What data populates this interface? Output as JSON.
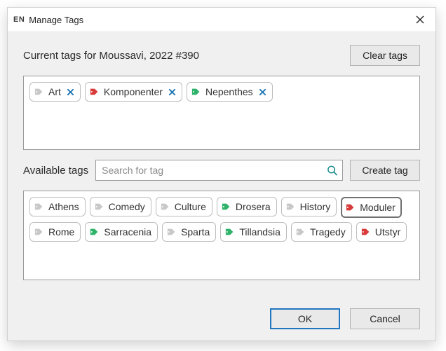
{
  "titlebar": {
    "app_badge": "EN",
    "title": "Manage Tags"
  },
  "header": {
    "current_tags_prefix": "Current tags for ",
    "reference": "Moussavi, 2022 #390",
    "clear_button": "Clear tags"
  },
  "current_tags": [
    {
      "label": "Art",
      "color": "#c8c8c8"
    },
    {
      "label": "Komponenter",
      "color": "#d83a3a"
    },
    {
      "label": "Nepenthes",
      "color": "#2fb36a"
    }
  ],
  "available": {
    "label": "Available tags",
    "search_placeholder": "Search for tag",
    "create_button": "Create tag"
  },
  "available_tags": [
    {
      "label": "Athens",
      "color": "#c8c8c8",
      "focused": false
    },
    {
      "label": "Comedy",
      "color": "#c8c8c8",
      "focused": false
    },
    {
      "label": "Culture",
      "color": "#c8c8c8",
      "focused": false
    },
    {
      "label": "Drosera",
      "color": "#2fb36a",
      "focused": false
    },
    {
      "label": "History",
      "color": "#c8c8c8",
      "focused": false
    },
    {
      "label": "Moduler",
      "color": "#d83a3a",
      "focused": true
    },
    {
      "label": "Rome",
      "color": "#c8c8c8",
      "focused": false
    },
    {
      "label": "Sarracenia",
      "color": "#2fb36a",
      "focused": false
    },
    {
      "label": "Sparta",
      "color": "#c8c8c8",
      "focused": false
    },
    {
      "label": "Tillandsia",
      "color": "#2fb36a",
      "focused": false
    },
    {
      "label": "Tragedy",
      "color": "#c8c8c8",
      "focused": false
    },
    {
      "label": "Utstyr",
      "color": "#d83a3a",
      "focused": false
    }
  ],
  "footer": {
    "ok": "OK",
    "cancel": "Cancel"
  },
  "colors": {
    "remove_x": "#1f77b4",
    "search_icon": "#178a8a"
  }
}
